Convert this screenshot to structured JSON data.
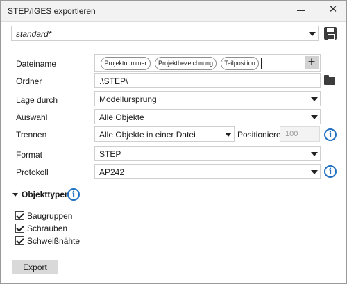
{
  "window": {
    "title": "STEP/IGES exportieren"
  },
  "preset": {
    "value": "standard*"
  },
  "fields": {
    "filename_label": "Dateiname",
    "filename_chips": [
      "Projektnummer",
      "Projektbezeichnung",
      "Teilposition"
    ],
    "folder_label": "Ordner",
    "folder_value": ".\\STEP\\",
    "position_label": "Lage durch",
    "position_value": "Modellursprung",
    "selection_label": "Auswahl",
    "selection_value": "Alle Objekte",
    "split_label": "Trennen",
    "split_value": "Alle Objekte in einer Datei",
    "positionieren_label": "Positionieren",
    "positionieren_value": "100",
    "format_label": "Format",
    "format_value": "STEP",
    "protocol_label": "Protokoll",
    "protocol_value": "AP242"
  },
  "object_types": {
    "title": "Objekttypen",
    "items": [
      {
        "label": "Baugruppen",
        "checked": true
      },
      {
        "label": "Schrauben",
        "checked": true
      },
      {
        "label": "Schweißnähte",
        "checked": true
      }
    ]
  },
  "actions": {
    "export_label": "Export"
  },
  "colors": {
    "accent": "#1f6fc2",
    "button_bg": "#d9d9d9"
  },
  "icons": [
    "minimize-icon",
    "close-icon",
    "chevron-down-icon",
    "save-icon",
    "plus-icon",
    "folder-icon",
    "info-icon",
    "checkmark-icon"
  ]
}
